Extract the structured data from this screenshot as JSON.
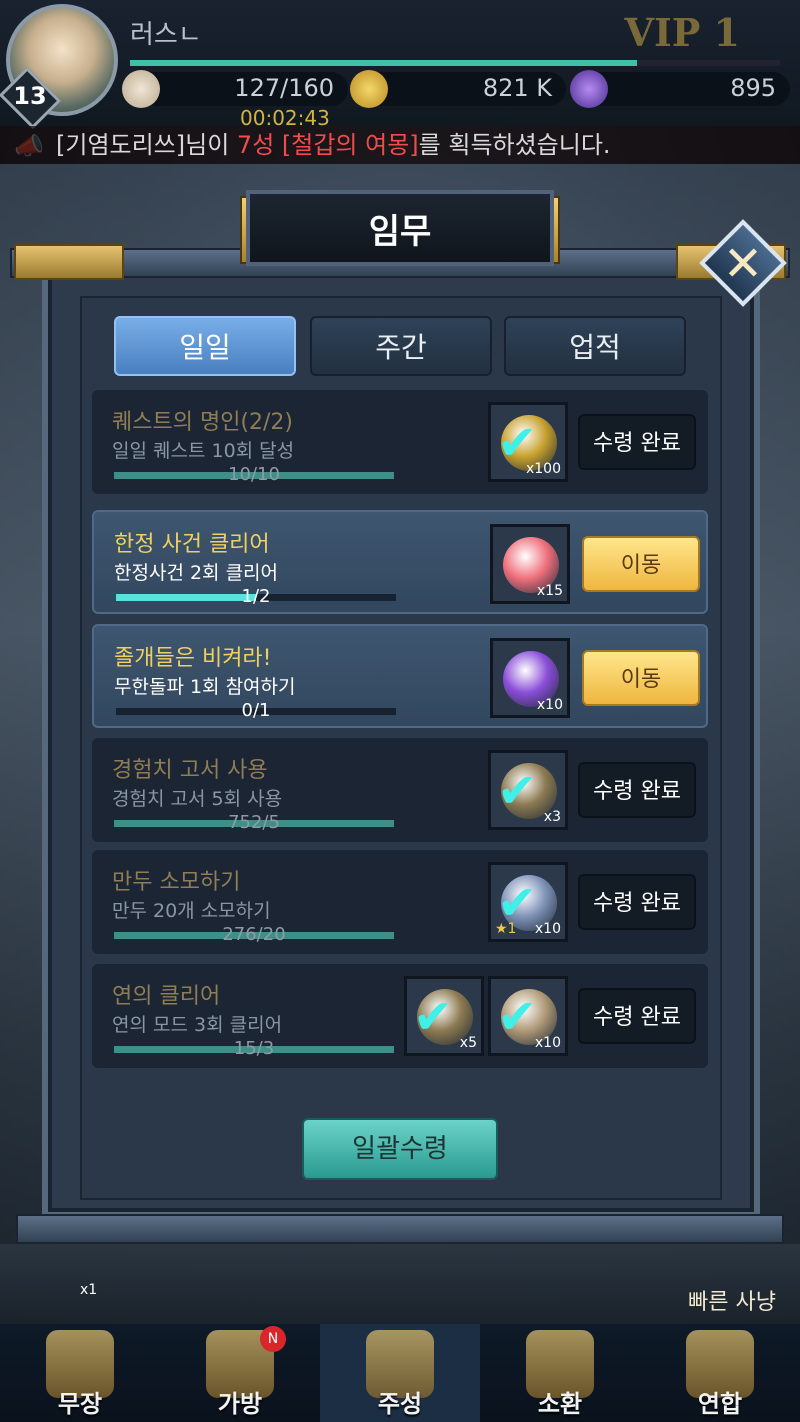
{
  "player": {
    "name": "러스ㄴ",
    "level": "13",
    "vip": "VIP 1",
    "xp_fraction": 0.78,
    "stamina": "127/160",
    "gold": "821 K",
    "gems": "895",
    "timer": "00:02:43"
  },
  "announcement": {
    "part1": "[기염도리쓰]님이 ",
    "highlight": "7성 [철갑의 여몽]",
    "part2": "를 획득하셨습니다."
  },
  "panel": {
    "title": "임무",
    "close_icon": "close-icon",
    "tabs": [
      {
        "label": "일일",
        "active": true
      },
      {
        "label": "주간",
        "active": false
      },
      {
        "label": "업적",
        "active": false
      }
    ],
    "claim_all_label": "일괄수령"
  },
  "quests": [
    {
      "title": "퀘스트의 명인(2/2)",
      "desc": "일일 퀘스트 10회 달성",
      "progress": "10/10",
      "fill": 1.0,
      "state": "done",
      "rewards": [
        {
          "icon": "gold-coin-icon",
          "qty": "x100",
          "color": "#c7a12e"
        }
      ],
      "action": "수령 완료"
    },
    {
      "title": "한정 사건 클리어",
      "desc": "한정사건 2회 클리어",
      "progress": "1/2",
      "fill": 0.5,
      "state": "open",
      "rewards": [
        {
          "icon": "pink-rune-icon",
          "qty": "x15",
          "color": "#ef6f7c"
        }
      ],
      "action": "이동"
    },
    {
      "title": "졸개들은 비켜라!",
      "desc": "무한돌파 1회 참여하기",
      "progress": "0/1",
      "fill": 0.0,
      "state": "open",
      "rewards": [
        {
          "icon": "purple-orb-icon",
          "qty": "x10",
          "color": "#8a4ed8"
        }
      ],
      "action": "이동"
    },
    {
      "title": "경험치 고서 사용",
      "desc": "경험치 고서 5회 사용",
      "progress": "752/5",
      "fill": 1.0,
      "state": "done",
      "rewards": [
        {
          "icon": "exp-book-icon",
          "qty": "x3",
          "color": "#8d7a52"
        }
      ],
      "action": "수령 완료"
    },
    {
      "title": "만두 소모하기",
      "desc": "만두 20개 소모하기",
      "progress": "276/20",
      "fill": 1.0,
      "state": "done",
      "rewards": [
        {
          "icon": "armor-ore-icon",
          "qty": "x10",
          "star": "★1",
          "color": "#7f93b8"
        }
      ],
      "action": "수령 완료"
    },
    {
      "title": "연의 클리어",
      "desc": "연의 모드 3회 클리어",
      "progress": "15/3",
      "fill": 1.0,
      "state": "done",
      "rewards": [
        {
          "icon": "scroll-icon",
          "qty": "x5",
          "color": "#8d7a52"
        },
        {
          "icon": "dumpling-icon",
          "qty": "x10",
          "color": "#b09a78"
        }
      ],
      "action": "수령 완료"
    }
  ],
  "side": {
    "key_qty": "x1",
    "quick_hunt": "빠른 사냥"
  },
  "nav": [
    {
      "label": "무장",
      "icon": "helmet-icon",
      "active": false,
      "badge": ""
    },
    {
      "label": "가방",
      "icon": "bag-icon",
      "active": false,
      "badge": "N"
    },
    {
      "label": "주성",
      "icon": "castle-icon",
      "active": true,
      "badge": ""
    },
    {
      "label": "소환",
      "icon": "summon-scroll-icon",
      "active": false,
      "badge": ""
    },
    {
      "label": "연합",
      "icon": "banner-icon",
      "active": false,
      "badge": ""
    }
  ]
}
